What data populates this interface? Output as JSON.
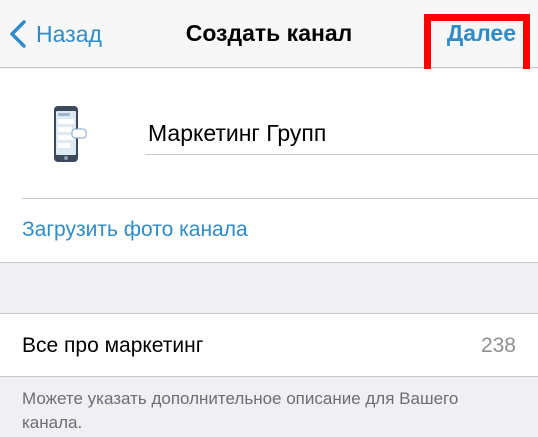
{
  "navbar": {
    "back_label": "Назад",
    "title": "Создать канал",
    "next_label": "Далее",
    "highlight_color": "#ff0000"
  },
  "channel": {
    "photo_icon": "phone-channel-photo-icon",
    "name_value": "Маркетинг Групп",
    "upload_photo_label": "Загрузить фото канала"
  },
  "description": {
    "value": "Все про маркетинг",
    "char_count": "238",
    "hint": "Можете указать дополнительное описание для Вашего канала."
  },
  "colors": {
    "accent": "#2d8cc9",
    "background": "#efeff4",
    "annotation": "#ff0000"
  }
}
